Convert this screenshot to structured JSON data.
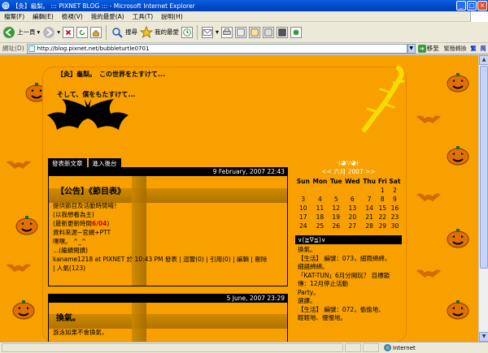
{
  "window": {
    "title": "【灸】龜梨。 ::: PIXNET BLOG ::: - Microsoft Internet Explorer",
    "buttons": [
      "_",
      "□",
      "×"
    ]
  },
  "menu": [
    "檔案(F)",
    "編輯(E)",
    "檢視(V)",
    "我的最愛(A)",
    "工具(T)",
    "說明(H)"
  ],
  "toolbar": {
    "back_label": "上一頁",
    "search_label": "搜尋",
    "favorites_label": "我的最愛"
  },
  "address": {
    "label": "網址(D)",
    "url": "http://blog.pixnet.net/bubbleturtle0701",
    "go_label": "移至",
    "extra1": "繁簡轉換",
    "extra2": "繁",
    "extra3": "简"
  },
  "blog": {
    "title": "【灸】龜梨。　この世界をたすけて...",
    "subtitle": "そして、僕をもたすけて..."
  },
  "tabs": [
    "發表新文章",
    "進入後台"
  ],
  "posts": [
    {
      "date": "9 February, 2007 22:43",
      "title": "【公告】《節目表》",
      "lines": [
        "提供節目及活動時間唷！",
        "(以我想看為主)",
        "(最新更新時間",
        "資料來源~官網+PTT",
        "嘿嘿。 ^_^",
        "...(繼續閱讀)",
        "kaname1218 at PIXNET 於 10:43 PM 發表 | 迴響(0) | 引用(0) | 編輯 | 刪除",
        "| 人氣(123)"
      ],
      "highlight": "6/04",
      "highlight_suffix": ")"
    },
    {
      "date": "5 June, 2007 23:29",
      "title": "換氣。",
      "lines": [
        "游泳如果不會換氣，"
      ]
    }
  ],
  "calendar": {
    "glyph": "·(◕▽◕)·",
    "nav": "<< 六月 2007 >>",
    "weekdays": [
      "Sun",
      "Mon",
      "Tue",
      "Wed",
      "Thu",
      "Fri",
      "Sat"
    ],
    "weeks": [
      [
        "",
        "",
        "",
        "",
        "",
        "1",
        "2"
      ],
      [
        "3",
        "4",
        "5",
        "6",
        "7",
        "8",
        "9"
      ],
      [
        "10",
        "11",
        "12",
        "13",
        "14",
        "15",
        "16"
      ],
      [
        "17",
        "18",
        "19",
        "20",
        "21",
        "22",
        "23"
      ],
      [
        "24",
        "25",
        "26",
        "27",
        "28",
        "29",
        "30"
      ]
    ]
  },
  "sidebar": {
    "heading": "∨(≧∇≦)∨",
    "items": [
      "換氣。",
      "【生活】 編號：073，細雨綿綿，",
      "細語綿綿。",
      "「KAT-TUN」6月分開玩？ 目標鎖",
      "傳：12月停止活動",
      "Party。",
      "選課。",
      "【生活】 編號：072，偷偷地、",
      "輕輕地、慢慢地。"
    ]
  },
  "status": {
    "zone": "Internet"
  },
  "colors": {
    "background": "#f7a000",
    "title_bar": "#0048c8",
    "highlight": "#cc0000"
  }
}
